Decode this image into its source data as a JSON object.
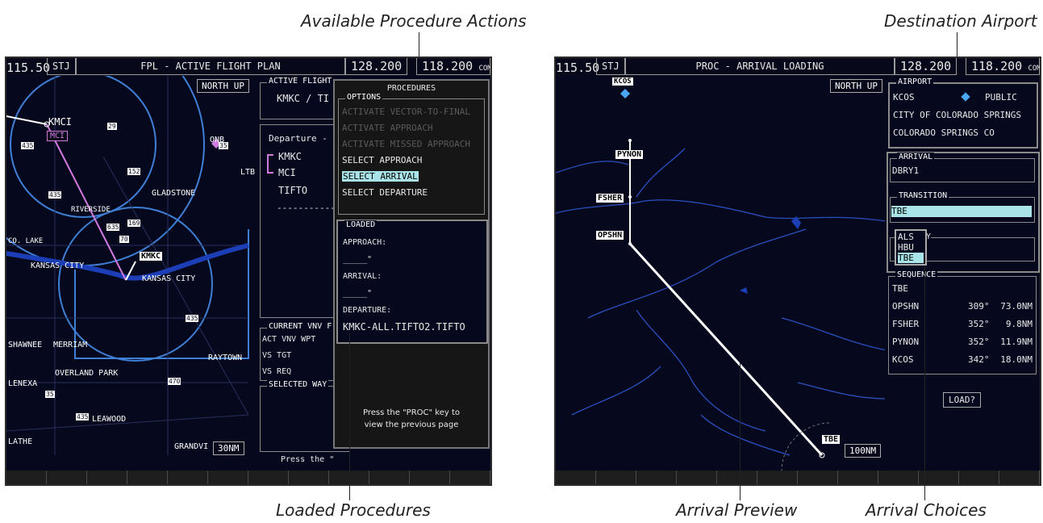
{
  "callouts": {
    "available_procedure_actions": "Available Procedure Actions",
    "destination_airport": "Destination Airport",
    "loaded_procedures": "Loaded Procedures",
    "arrival_preview": "Arrival Preview",
    "arrival_choices": "Arrival Choices"
  },
  "left": {
    "topbar": {
      "nav": "115.50",
      "nav_id": "STJ",
      "title": "FPL - ACTIVE FLIGHT PLAN",
      "com_active": "128.200",
      "com_standby": "118.200",
      "com_label": "COM2"
    },
    "map": {
      "orientation": "NORTH UP",
      "range": "30NM",
      "labels": {
        "kmci": "KMCI",
        "mci": "MCI",
        "onb": "ONB",
        "ltb": "LTB",
        "gladstone": "GLADSTONE",
        "riverside": "RIVERSIDE",
        "co_lake": "CO. LAKE",
        "kansas_city_w": "KANSAS CITY",
        "kansas_city_e": "KANSAS CITY",
        "kmkc": "KMKC",
        "shawnee": "SHAWNEE",
        "merriam": "MERRIAM",
        "raytown": "RAYTOWN",
        "overland_park": "OVERLAND PARK",
        "lenexa": "LENEXA",
        "leawood": "LEAWOOD",
        "olathe": "LATHE",
        "grandview": "GRANDVI"
      },
      "highways": {
        "h435a": "435",
        "h435b": "435",
        "h435c": "435",
        "h435d": "435",
        "h635": "635",
        "h29": "29",
        "h35a": "35",
        "h35b": "35",
        "h169": "169",
        "h70": "70",
        "h470": "470",
        "h152": "152"
      }
    },
    "fpl": {
      "active_flight": "ACTIVE FLIGHT",
      "route": "KMKC / TI",
      "departure": "Departure - K",
      "wp1": "KMKC",
      "wp2": "MCI",
      "wp3": "TIFTO",
      "dashes": "------------",
      "current_vnv": "CURRENT VNV F",
      "act_vnv_wpt": "ACT VNV WPT",
      "vs_tgt": "VS TGT",
      "vs_req": "VS REQ",
      "selected_way": "SELECTED WAY",
      "press_the": "Press the \""
    },
    "procedures": {
      "title": "PROCEDURES",
      "options": "OPTIONS",
      "items": [
        "ACTIVATE VECTOR-TO-FINAL",
        "ACTIVATE APPROACH",
        "ACTIVATE MISSED APPROACH",
        "SELECT APPROACH",
        "SELECT ARRIVAL",
        "SELECT DEPARTURE"
      ]
    },
    "loaded": {
      "title": "LOADED",
      "approach": "APPROACH:",
      "approach_val": "_____\"",
      "arrival": "ARRIVAL:",
      "arrival_val": "_____\"",
      "departure": "DEPARTURE:",
      "departure_val": "KMKC-ALL.TIFTO2.TIFTO"
    },
    "hint": {
      "line1": "Press the \"PROC\" key to",
      "line2": "view the previous page"
    }
  },
  "right": {
    "topbar": {
      "nav": "115.50",
      "nav_id": "STJ",
      "title": "PROC - ARRIVAL LOADING",
      "com_active": "128.200",
      "com_standby": "118.200",
      "com_label": "COM2"
    },
    "map": {
      "orientation": "NORTH UP",
      "range": "100NM",
      "waypoints": {
        "kcos": "KCOS",
        "pynon": "PYNON",
        "fsher": "FSHER",
        "opshn": "OPSHN",
        "tbe": "TBE"
      }
    },
    "airport": {
      "title": "AIRPORT",
      "ident": "KCOS",
      "type": "PUBLIC",
      "name": "CITY OF COLORADO SPRINGS",
      "city": "COLORADO SPRINGS CO"
    },
    "arrival": {
      "title": "ARRIVAL",
      "value": "DBRY1"
    },
    "transition": {
      "title": "TRANSITION",
      "value": "TBE",
      "choices": [
        "ALS",
        "HBU",
        "TBE"
      ],
      "hidden_label": "Y"
    },
    "sequence": {
      "title": "SEQUENCE",
      "header": "TBE",
      "rows": [
        {
          "wpt": "OPSHN",
          "crs": "309°",
          "dist": "73.0NM"
        },
        {
          "wpt": "FSHER",
          "crs": "352°",
          "dist": "9.8NM"
        },
        {
          "wpt": "PYNON",
          "crs": "352°",
          "dist": "11.9NM"
        },
        {
          "wpt": "KCOS",
          "crs": "342°",
          "dist": "18.0NM"
        }
      ]
    },
    "load_button": "LOAD?"
  },
  "colors": {
    "screen_bg": "#06091e",
    "highlight": "#a9e4e8",
    "route": "#d07ae0",
    "water": "#1c3fb8",
    "airspace": "#3f7fd6"
  }
}
